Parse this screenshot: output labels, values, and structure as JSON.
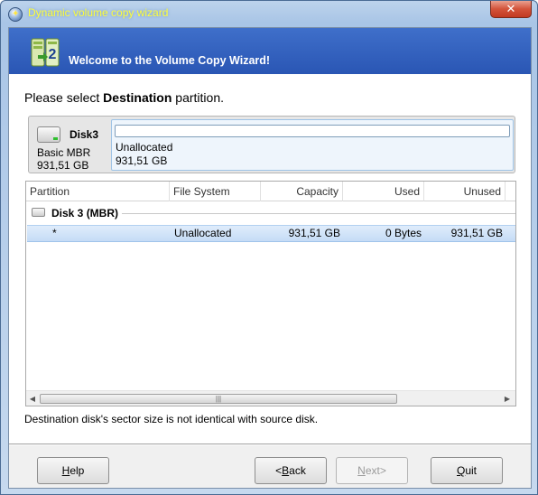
{
  "window": {
    "title": "Dynamic volume copy wizard",
    "close_symbol": "✕"
  },
  "banner": {
    "title": "Welcome to the Volume Copy Wizard!"
  },
  "prompt": {
    "prefix": "Please select ",
    "emphasis": "Destination",
    "suffix": " partition."
  },
  "disk": {
    "name": "Disk3",
    "type": "Basic MBR",
    "size": "931,51 GB",
    "partition_label": "Unallocated",
    "partition_size": "931,51 GB"
  },
  "table": {
    "columns": [
      "Partition",
      "File System",
      "Capacity",
      "Used",
      "Unused"
    ],
    "group_label": "Disk 3 (MBR)",
    "rows": [
      {
        "partition": "*",
        "file_system": "Unallocated",
        "capacity": "931,51 GB",
        "used": "0 Bytes",
        "unused": "931,51 GB"
      }
    ]
  },
  "note": "Destination disk's sector size is not identical with source disk.",
  "buttons": {
    "help": {
      "mnemonic": "H",
      "rest": "elp"
    },
    "back": {
      "pre": "<",
      "mnemonic": "B",
      "rest": "ack"
    },
    "next": {
      "mnemonic": "N",
      "rest": "ext>"
    },
    "quit": {
      "mnemonic": "Q",
      "rest": "uit"
    }
  },
  "colors": {
    "banner": "#3f6fca",
    "title_text": "#ffff3a",
    "selection": "#c5dcf6"
  },
  "icons": {
    "app": "gear-disk-icon",
    "banner": "volume-copy-icon",
    "disk": "hard-disk-icon",
    "close": "close-icon"
  }
}
